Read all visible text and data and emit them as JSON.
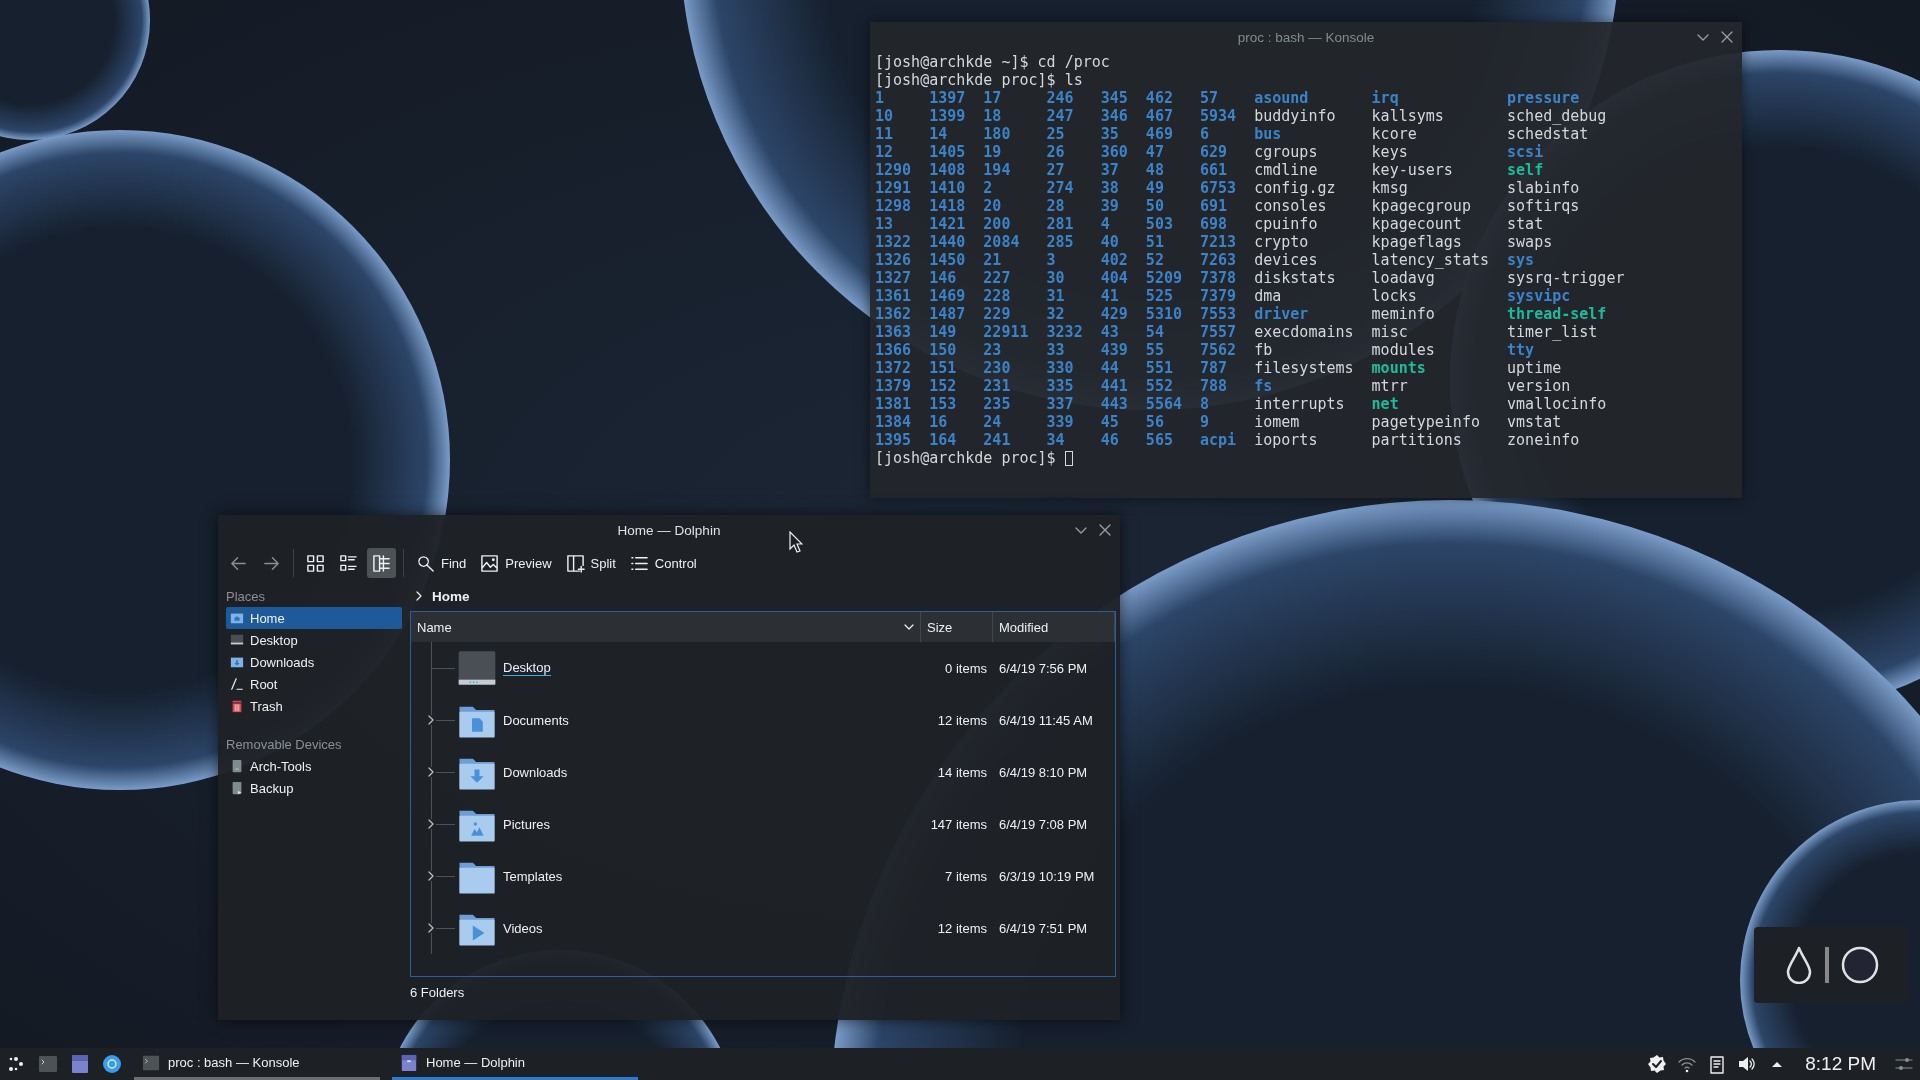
{
  "konsole": {
    "title": "proc : bash — Konsole",
    "lines": [
      "[josh@archkde ~]$ cd /proc",
      "[josh@archkde proc]$ ls"
    ],
    "listing": [
      [
        {
          "text": "1",
          "kind": "dir"
        },
        {
          "text": "10",
          "kind": "dir"
        },
        {
          "text": "11",
          "kind": "dir"
        },
        {
          "text": "12",
          "kind": "dir"
        },
        {
          "text": "1290",
          "kind": "dir"
        },
        {
          "text": "1291",
          "kind": "dir"
        },
        {
          "text": "1298",
          "kind": "dir"
        },
        {
          "text": "13",
          "kind": "dir"
        },
        {
          "text": "1322",
          "kind": "dir"
        },
        {
          "text": "1326",
          "kind": "dir"
        },
        {
          "text": "1327",
          "kind": "dir"
        },
        {
          "text": "1361",
          "kind": "dir"
        },
        {
          "text": "1362",
          "kind": "dir"
        },
        {
          "text": "1363",
          "kind": "dir"
        },
        {
          "text": "1366",
          "kind": "dir"
        },
        {
          "text": "1372",
          "kind": "dir"
        },
        {
          "text": "1379",
          "kind": "dir"
        },
        {
          "text": "1381",
          "kind": "dir"
        },
        {
          "text": "1384",
          "kind": "dir"
        },
        {
          "text": "1395",
          "kind": "dir"
        }
      ],
      [
        {
          "text": "1397",
          "kind": "dir"
        },
        {
          "text": "1399",
          "kind": "dir"
        },
        {
          "text": "14",
          "kind": "dir"
        },
        {
          "text": "1405",
          "kind": "dir"
        },
        {
          "text": "1408",
          "kind": "dir"
        },
        {
          "text": "1410",
          "kind": "dir"
        },
        {
          "text": "1418",
          "kind": "dir"
        },
        {
          "text": "1421",
          "kind": "dir"
        },
        {
          "text": "1440",
          "kind": "dir"
        },
        {
          "text": "1450",
          "kind": "dir"
        },
        {
          "text": "146",
          "kind": "dir"
        },
        {
          "text": "1469",
          "kind": "dir"
        },
        {
          "text": "1487",
          "kind": "dir"
        },
        {
          "text": "149",
          "kind": "dir"
        },
        {
          "text": "150",
          "kind": "dir"
        },
        {
          "text": "151",
          "kind": "dir"
        },
        {
          "text": "152",
          "kind": "dir"
        },
        {
          "text": "153",
          "kind": "dir"
        },
        {
          "text": "16",
          "kind": "dir"
        },
        {
          "text": "164",
          "kind": "dir"
        }
      ],
      [
        {
          "text": "17",
          "kind": "dir"
        },
        {
          "text": "18",
          "kind": "dir"
        },
        {
          "text": "180",
          "kind": "dir"
        },
        {
          "text": "19",
          "kind": "dir"
        },
        {
          "text": "194",
          "kind": "dir"
        },
        {
          "text": "2",
          "kind": "dir"
        },
        {
          "text": "20",
          "kind": "dir"
        },
        {
          "text": "200",
          "kind": "dir"
        },
        {
          "text": "2084",
          "kind": "dir"
        },
        {
          "text": "21",
          "kind": "dir"
        },
        {
          "text": "227",
          "kind": "dir"
        },
        {
          "text": "228",
          "kind": "dir"
        },
        {
          "text": "229",
          "kind": "dir"
        },
        {
          "text": "22911",
          "kind": "dir"
        },
        {
          "text": "23",
          "kind": "dir"
        },
        {
          "text": "230",
          "kind": "dir"
        },
        {
          "text": "231",
          "kind": "dir"
        },
        {
          "text": "235",
          "kind": "dir"
        },
        {
          "text": "24",
          "kind": "dir"
        },
        {
          "text": "241",
          "kind": "dir"
        }
      ],
      [
        {
          "text": "246",
          "kind": "dir"
        },
        {
          "text": "247",
          "kind": "dir"
        },
        {
          "text": "25",
          "kind": "dir"
        },
        {
          "text": "26",
          "kind": "dir"
        },
        {
          "text": "27",
          "kind": "dir"
        },
        {
          "text": "274",
          "kind": "dir"
        },
        {
          "text": "28",
          "kind": "dir"
        },
        {
          "text": "281",
          "kind": "dir"
        },
        {
          "text": "285",
          "kind": "dir"
        },
        {
          "text": "3",
          "kind": "dir"
        },
        {
          "text": "30",
          "kind": "dir"
        },
        {
          "text": "31",
          "kind": "dir"
        },
        {
          "text": "32",
          "kind": "dir"
        },
        {
          "text": "3232",
          "kind": "dir"
        },
        {
          "text": "33",
          "kind": "dir"
        },
        {
          "text": "330",
          "kind": "dir"
        },
        {
          "text": "335",
          "kind": "dir"
        },
        {
          "text": "337",
          "kind": "dir"
        },
        {
          "text": "339",
          "kind": "dir"
        },
        {
          "text": "34",
          "kind": "dir"
        }
      ],
      [
        {
          "text": "345",
          "kind": "dir"
        },
        {
          "text": "346",
          "kind": "dir"
        },
        {
          "text": "35",
          "kind": "dir"
        },
        {
          "text": "360",
          "kind": "dir"
        },
        {
          "text": "37",
          "kind": "dir"
        },
        {
          "text": "38",
          "kind": "dir"
        },
        {
          "text": "39",
          "kind": "dir"
        },
        {
          "text": "4",
          "kind": "dir"
        },
        {
          "text": "40",
          "kind": "dir"
        },
        {
          "text": "402",
          "kind": "dir"
        },
        {
          "text": "404",
          "kind": "dir"
        },
        {
          "text": "41",
          "kind": "dir"
        },
        {
          "text": "429",
          "kind": "dir"
        },
        {
          "text": "43",
          "kind": "dir"
        },
        {
          "text": "439",
          "kind": "dir"
        },
        {
          "text": "44",
          "kind": "dir"
        },
        {
          "text": "441",
          "kind": "dir"
        },
        {
          "text": "443",
          "kind": "dir"
        },
        {
          "text": "45",
          "kind": "dir"
        },
        {
          "text": "46",
          "kind": "dir"
        }
      ],
      [
        {
          "text": "462",
          "kind": "dir"
        },
        {
          "text": "467",
          "kind": "dir"
        },
        {
          "text": "469",
          "kind": "dir"
        },
        {
          "text": "47",
          "kind": "dir"
        },
        {
          "text": "48",
          "kind": "dir"
        },
        {
          "text": "49",
          "kind": "dir"
        },
        {
          "text": "50",
          "kind": "dir"
        },
        {
          "text": "503",
          "kind": "dir"
        },
        {
          "text": "51",
          "kind": "dir"
        },
        {
          "text": "52",
          "kind": "dir"
        },
        {
          "text": "5209",
          "kind": "dir"
        },
        {
          "text": "525",
          "kind": "dir"
        },
        {
          "text": "5310",
          "kind": "dir"
        },
        {
          "text": "54",
          "kind": "dir"
        },
        {
          "text": "55",
          "kind": "dir"
        },
        {
          "text": "551",
          "kind": "dir"
        },
        {
          "text": "552",
          "kind": "dir"
        },
        {
          "text": "5564",
          "kind": "dir"
        },
        {
          "text": "56",
          "kind": "dir"
        },
        {
          "text": "565",
          "kind": "dir"
        }
      ],
      [
        {
          "text": "57",
          "kind": "dir"
        },
        {
          "text": "5934",
          "kind": "dir"
        },
        {
          "text": "6",
          "kind": "dir"
        },
        {
          "text": "629",
          "kind": "dir"
        },
        {
          "text": "661",
          "kind": "dir"
        },
        {
          "text": "6753",
          "kind": "dir"
        },
        {
          "text": "691",
          "kind": "dir"
        },
        {
          "text": "698",
          "kind": "dir"
        },
        {
          "text": "7213",
          "kind": "dir"
        },
        {
          "text": "7263",
          "kind": "dir"
        },
        {
          "text": "7378",
          "kind": "dir"
        },
        {
          "text": "7379",
          "kind": "dir"
        },
        {
          "text": "7553",
          "kind": "dir"
        },
        {
          "text": "7557",
          "kind": "dir"
        },
        {
          "text": "7562",
          "kind": "dir"
        },
        {
          "text": "787",
          "kind": "dir"
        },
        {
          "text": "788",
          "kind": "dir"
        },
        {
          "text": "8",
          "kind": "dir"
        },
        {
          "text": "9",
          "kind": "dir"
        },
        {
          "text": "acpi",
          "kind": "dir"
        }
      ],
      [
        {
          "text": "asound",
          "kind": "dir"
        },
        {
          "text": "buddyinfo",
          "kind": "file"
        },
        {
          "text": "bus",
          "kind": "dir"
        },
        {
          "text": "cgroups",
          "kind": "file"
        },
        {
          "text": "cmdline",
          "kind": "file"
        },
        {
          "text": "config.gz",
          "kind": "file"
        },
        {
          "text": "consoles",
          "kind": "file"
        },
        {
          "text": "cpuinfo",
          "kind": "file"
        },
        {
          "text": "crypto",
          "kind": "file"
        },
        {
          "text": "devices",
          "kind": "file"
        },
        {
          "text": "diskstats",
          "kind": "file"
        },
        {
          "text": "dma",
          "kind": "file"
        },
        {
          "text": "driver",
          "kind": "dir"
        },
        {
          "text": "execdomains",
          "kind": "file"
        },
        {
          "text": "fb",
          "kind": "file"
        },
        {
          "text": "filesystems",
          "kind": "file"
        },
        {
          "text": "fs",
          "kind": "dir"
        },
        {
          "text": "interrupts",
          "kind": "file"
        },
        {
          "text": "iomem",
          "kind": "file"
        },
        {
          "text": "ioports",
          "kind": "file"
        }
      ],
      [
        {
          "text": "irq",
          "kind": "dir"
        },
        {
          "text": "kallsyms",
          "kind": "file"
        },
        {
          "text": "kcore",
          "kind": "file"
        },
        {
          "text": "keys",
          "kind": "file"
        },
        {
          "text": "key-users",
          "kind": "file"
        },
        {
          "text": "kmsg",
          "kind": "file"
        },
        {
          "text": "kpagecgroup",
          "kind": "file"
        },
        {
          "text": "kpagecount",
          "kind": "file"
        },
        {
          "text": "kpageflags",
          "kind": "file"
        },
        {
          "text": "latency_stats",
          "kind": "file"
        },
        {
          "text": "loadavg",
          "kind": "file"
        },
        {
          "text": "locks",
          "kind": "file"
        },
        {
          "text": "meminfo",
          "kind": "file"
        },
        {
          "text": "misc",
          "kind": "file"
        },
        {
          "text": "modules",
          "kind": "file"
        },
        {
          "text": "mounts",
          "kind": "link"
        },
        {
          "text": "mtrr",
          "kind": "file"
        },
        {
          "text": "net",
          "kind": "link"
        },
        {
          "text": "pagetypeinfo",
          "kind": "file"
        },
        {
          "text": "partitions",
          "kind": "file"
        }
      ],
      [
        {
          "text": "pressure",
          "kind": "dir"
        },
        {
          "text": "sched_debug",
          "kind": "file"
        },
        {
          "text": "schedstat",
          "kind": "file"
        },
        {
          "text": "scsi",
          "kind": "dir"
        },
        {
          "text": "self",
          "kind": "link"
        },
        {
          "text": "slabinfo",
          "kind": "file"
        },
        {
          "text": "softirqs",
          "kind": "file"
        },
        {
          "text": "stat",
          "kind": "file"
        },
        {
          "text": "swaps",
          "kind": "file"
        },
        {
          "text": "sys",
          "kind": "dir"
        },
        {
          "text": "sysrq-trigger",
          "kind": "file"
        },
        {
          "text": "sysvipc",
          "kind": "dir"
        },
        {
          "text": "thread-self",
          "kind": "link"
        },
        {
          "text": "timer_list",
          "kind": "file"
        },
        {
          "text": "tty",
          "kind": "dir"
        },
        {
          "text": "uptime",
          "kind": "file"
        },
        {
          "text": "version",
          "kind": "file"
        },
        {
          "text": "vmallocinfo",
          "kind": "file"
        },
        {
          "text": "vmstat",
          "kind": "file"
        },
        {
          "text": "zoneinfo",
          "kind": "file"
        }
      ]
    ],
    "prompt": "[josh@archkde proc]$"
  },
  "dolphin": {
    "title": "Home — Dolphin",
    "view_modes": [
      {
        "kind": "icons",
        "selected": false
      },
      {
        "kind": "compact",
        "selected": false
      },
      {
        "kind": "details",
        "selected": true
      }
    ],
    "actions": [
      {
        "label": "Find",
        "kind": "find"
      },
      {
        "label": "Preview",
        "kind": "preview"
      },
      {
        "label": "Split",
        "kind": "split"
      },
      {
        "label": "Control",
        "kind": "control"
      }
    ],
    "places": {
      "heading": "Places",
      "items": [
        {
          "label": "Home",
          "kind": "home",
          "selected": true
        },
        {
          "label": "Desktop",
          "kind": "desktop",
          "selected": false
        },
        {
          "label": "Downloads",
          "kind": "downloads",
          "selected": false
        },
        {
          "label": "Root",
          "kind": "root",
          "selected": false
        },
        {
          "label": "Trash",
          "kind": "trash",
          "selected": false
        }
      ]
    },
    "devices": {
      "heading": "Removable Devices",
      "items": [
        {
          "label": "Arch-Tools",
          "kind": "drive",
          "selected": false
        },
        {
          "label": "Backup",
          "kind": "backup",
          "selected": false
        }
      ]
    },
    "breadcrumb": "Home",
    "columns": [
      "Name",
      "Size",
      "Modified"
    ],
    "rows": [
      {
        "name": "Desktop",
        "kind": "desktop",
        "expandable": false,
        "hovered": true,
        "size": "0 items",
        "modified": "6/4/19 7:56 PM"
      },
      {
        "name": "Documents",
        "kind": "documents",
        "expandable": true,
        "hovered": false,
        "size": "12 items",
        "modified": "6/4/19 11:45 AM"
      },
      {
        "name": "Downloads",
        "kind": "downloads",
        "expandable": true,
        "hovered": false,
        "size": "14 items",
        "modified": "6/4/19 8:10 PM"
      },
      {
        "name": "Pictures",
        "kind": "pictures",
        "expandable": true,
        "hovered": false,
        "size": "147 items",
        "modified": "6/4/19 7:08 PM"
      },
      {
        "name": "Templates",
        "kind": "templates",
        "expandable": true,
        "hovered": false,
        "size": "7 items",
        "modified": "6/3/19 10:19 PM"
      },
      {
        "name": "Videos",
        "kind": "videos",
        "expandable": true,
        "hovered": false,
        "size": "12 items",
        "modified": "6/4/19 7:51 PM"
      }
    ],
    "status": "6 Folders"
  },
  "taskbar": {
    "tasks": [
      {
        "label": "proc : bash — Konsole",
        "kind": "terminal",
        "selected": false
      },
      {
        "label": "Home — Dolphin",
        "kind": "dolphin",
        "selected": true
      }
    ],
    "clock": "8:12 PM"
  }
}
